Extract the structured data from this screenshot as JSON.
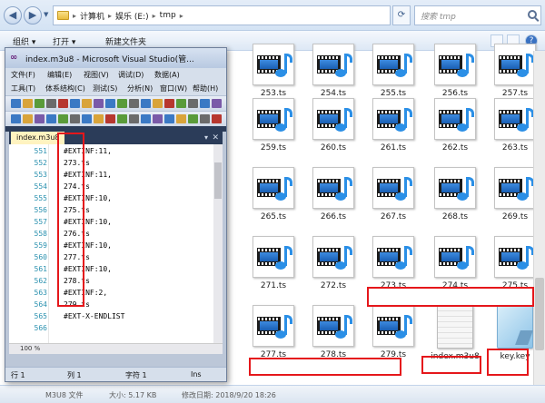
{
  "explorer": {
    "breadcrumb": [
      "计算机",
      "娱乐 (E:)",
      "tmp"
    ],
    "search_placeholder": "搜索 tmp",
    "commands": {
      "organize": "组织 ▾",
      "open": "打开 ▾",
      "new_folder": "新建文件夹"
    },
    "files": [
      "253.ts",
      "254.ts",
      "255.ts",
      "256.ts",
      "257.ts",
      "259.ts",
      "260.ts",
      "261.ts",
      "262.ts",
      "263.ts",
      "265.ts",
      "266.ts",
      "267.ts",
      "268.ts",
      "269.ts",
      "271.ts",
      "272.ts",
      "273.ts",
      "274.ts",
      "275.ts",
      "277.ts",
      "278.ts",
      "279.ts",
      "index.m3u8",
      "key.key"
    ],
    "status": {
      "type": "M3U8 文件",
      "size": "大小: 5.17 KB",
      "date": "修改日期: 2018/9/20 18:26"
    }
  },
  "vs": {
    "title": "index.m3u8 - Microsoft Visual Studio(管...",
    "menu1": [
      "文件(F)",
      "编辑(E)",
      "视图(V)",
      "调试(D)",
      "数据(A)"
    ],
    "menu2": [
      "工具(T)",
      "体系结构(C)",
      "测试(S)",
      "分析(N)",
      "窗口(W)",
      "帮助(H)"
    ],
    "doc_tab": "index.m3u8",
    "lines": [
      {
        "n": "551",
        "t": "#EXTINF:11,"
      },
      {
        "n": "552",
        "t": "273.ts"
      },
      {
        "n": "553",
        "t": "#EXTINF:11,"
      },
      {
        "n": "554",
        "t": "274.ts"
      },
      {
        "n": "555",
        "t": "#EXTINF:10,"
      },
      {
        "n": "556",
        "t": "275.ts"
      },
      {
        "n": "557",
        "t": "#EXTINF:10,"
      },
      {
        "n": "558",
        "t": "276.ts"
      },
      {
        "n": "559",
        "t": "#EXTINF:10,"
      },
      {
        "n": "560",
        "t": "277.ts"
      },
      {
        "n": "561",
        "t": "#EXTINF:10,"
      },
      {
        "n": "562",
        "t": "278.ts"
      },
      {
        "n": "563",
        "t": "#EXTINF:2,"
      },
      {
        "n": "564",
        "t": "279.ts"
      },
      {
        "n": "565",
        "t": "#EXT-X-ENDLIST"
      },
      {
        "n": "566",
        "t": ""
      }
    ],
    "zoom": "100 %",
    "status": {
      "row": "行 1",
      "col": "列 1",
      "ch": "字符 1",
      "ins": "Ins"
    }
  },
  "colors": {
    "highlight": "#e5171b",
    "vs_dark": "#2b3c59"
  }
}
